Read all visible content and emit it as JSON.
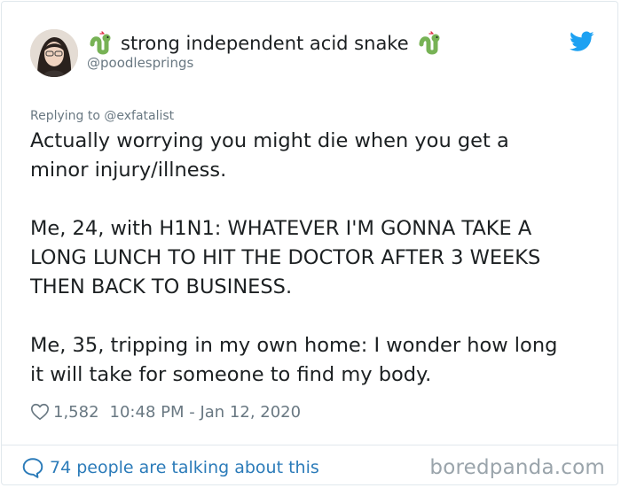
{
  "tweet": {
    "display_name": "strong independent acid snake",
    "name_icon": "snake-emoji",
    "handle": "@poodlesprings",
    "reply_context": "Replying to @exfatalist",
    "paragraphs": [
      [
        "Actually worrying you might die when you get a",
        "minor injury/illness."
      ],
      [
        "Me, 24, with H1N1: WHATEVER I'M GONNA TAKE A",
        "LONG LUNCH TO HIT THE DOCTOR AFTER 3 WEEKS",
        "THEN BACK TO BUSINESS."
      ],
      [
        "Me, 35, tripping in my own home: I wonder how long",
        "it will take for someone to find my body."
      ]
    ],
    "like_count": "1,582",
    "timestamp": "10:48 PM - Jan 12, 2020",
    "platform_icon": "twitter-bird-icon"
  },
  "footer": {
    "conversation_label": "74 people are talking about this",
    "watermark": "boredpanda.com"
  },
  "colors": {
    "text": "#1c2022",
    "muted": "#697882",
    "link": "#2b7bb9",
    "twitter_blue": "#1da1f2",
    "border": "#e1e8ed",
    "watermark": "#9aa4ab",
    "snake_green": "#77b255"
  }
}
